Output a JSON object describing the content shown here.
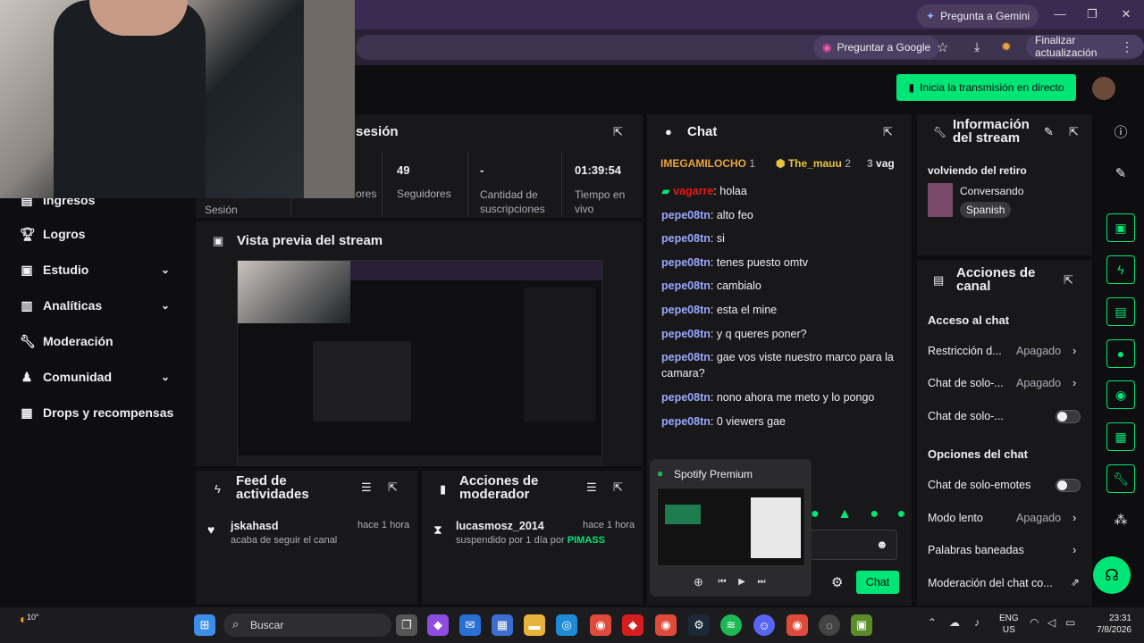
{
  "browser": {
    "gemini_label": "Pregunta a Gemini",
    "ask_google_label": "Preguntar a Google",
    "finish_update_label": "Finalizar actualización"
  },
  "header": {
    "go_live_label": "Inicia la transmisión en directo"
  },
  "session": {
    "title": "sesión",
    "session_label": "Sesión",
    "stats": [
      {
        "value": "",
        "label": "Espectadores",
        "partial": "ores"
      },
      {
        "value": "49",
        "label": "Seguidores"
      },
      {
        "value": "-",
        "label": "Cantidad de suscripciones"
      },
      {
        "value": "01:39:54",
        "label": "Tiempo en vivo"
      }
    ]
  },
  "sidebar": {
    "items": [
      {
        "label": "Ingresos",
        "icon": "money-icon"
      },
      {
        "label": "Logros",
        "icon": "trophy-icon"
      },
      {
        "label": "Estudio",
        "icon": "studio-icon",
        "expandable": true
      },
      {
        "label": "Analíticas",
        "icon": "chart-icon",
        "expandable": true
      },
      {
        "label": "Moderación",
        "icon": "wrench-icon"
      },
      {
        "label": "Comunidad",
        "icon": "community-icon",
        "expandable": true
      },
      {
        "label": "Drops y recompensas",
        "icon": "gift-icon"
      }
    ]
  },
  "preview": {
    "title": "Vista previa del stream"
  },
  "feed": {
    "title": "Feed de actividades",
    "items": [
      {
        "user": "jskahasd",
        "action": "acaba de seguir el canal",
        "time": "hace 1 hora"
      }
    ]
  },
  "mod_actions": {
    "title": "Acciones de moderador",
    "items": [
      {
        "user": "lucasmosz_2014",
        "action": "suspendido por 1 día por",
        "by": "PIMASS",
        "time": "hace 1 hora"
      }
    ]
  },
  "chat": {
    "title": "Chat",
    "top_chatters": [
      {
        "name": "IMEGAMILOCHO",
        "rank": "1"
      },
      {
        "name": "The_mauu",
        "rank": "2"
      },
      {
        "name": "vag",
        "rank": "3"
      }
    ],
    "messages": [
      {
        "user": "vagarre",
        "text": "holaa",
        "color": "#e91916"
      },
      {
        "user": "pepe08tn",
        "text": "alto feo"
      },
      {
        "user": "pepe08tn",
        "text": "si"
      },
      {
        "user": "pepe08tn",
        "text": "tenes puesto omtv"
      },
      {
        "user": "pepe08tn",
        "text": "cambialo"
      },
      {
        "user": "pepe08tn",
        "text": "esta el mine"
      },
      {
        "user": "pepe08tn",
        "text": "y q queres poner?"
      },
      {
        "user": "pepe08tn",
        "text": "gae vos viste nuestro marco para la camara?"
      },
      {
        "user": "pepe08tn",
        "text": "nono ahora me meto y lo pongo"
      },
      {
        "user": "pepe08tn",
        "text": "0 viewers gae"
      }
    ],
    "send_label": "Chat"
  },
  "spotify": {
    "title": "Spotify Premium"
  },
  "stream_info": {
    "title": "Información del stream",
    "stream_title": "volviendo del retiro",
    "category": "Conversando",
    "language": "Spanish"
  },
  "channel_actions": {
    "title": "Acciones de canal",
    "access_heading": "Acceso al chat",
    "rows": [
      {
        "label": "Restricción d...",
        "value": "Apagado",
        "kind": "link"
      },
      {
        "label": "Chat de solo-...",
        "value": "Apagado",
        "kind": "link"
      },
      {
        "label": "Chat de solo-...",
        "value": "",
        "kind": "toggle"
      }
    ],
    "options_heading": "Opciones del chat",
    "options": [
      {
        "label": "Chat de solo-emotes",
        "value": "",
        "kind": "toggle"
      },
      {
        "label": "Modo lento",
        "value": "Apagado",
        "kind": "link"
      },
      {
        "label": "Palabras baneadas",
        "value": "",
        "kind": "link"
      },
      {
        "label": "Moderación del chat co...",
        "value": "",
        "kind": "external"
      }
    ]
  },
  "taskbar": {
    "search_placeholder": "Buscar",
    "weather": "10°",
    "lang_top": "ENG",
    "lang_bottom": "US",
    "time": "23:31",
    "date": "7/8/2026"
  }
}
